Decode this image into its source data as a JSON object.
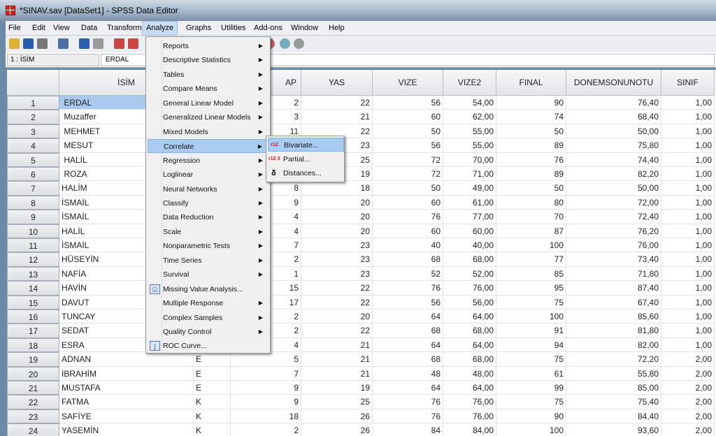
{
  "window": {
    "title": "*SINAV.sav [DataSet1] - SPSS Data Editor"
  },
  "menubar": [
    {
      "label": "File"
    },
    {
      "label": "Edit"
    },
    {
      "label": "View"
    },
    {
      "label": "Data"
    },
    {
      "label": "Transform"
    },
    {
      "label": "Analyze",
      "active": true
    },
    {
      "label": "Graphs"
    },
    {
      "label": "Utilities"
    },
    {
      "label": "Add-ons"
    },
    {
      "label": "Window"
    },
    {
      "label": "Help"
    }
  ],
  "toolbar": {
    "icons": [
      "open-folder-icon",
      "save-icon",
      "print-icon",
      "dialog-recall-icon",
      "undo-icon",
      "redo-icon",
      "goto-case-icon",
      "goto-variable-icon",
      "value-labels-icon",
      "use-sets-icon",
      "show-all-variables-icon"
    ]
  },
  "cellbar": {
    "ref": "1 : İSİM",
    "value": "ERDAL"
  },
  "columns": [
    "İSİM",
    "",
    "AP",
    "YAS",
    "VIZE",
    "VIZE2",
    "FINAL",
    "DONEMSONUNOTU",
    "SINIF"
  ],
  "rows": [
    [
      "1",
      " ERDAL",
      "",
      "2",
      "22",
      "56",
      "54,00",
      "90",
      "76,40",
      "1,00"
    ],
    [
      "2",
      " Muzaffer",
      "",
      "3",
      "21",
      "60",
      "62,00",
      "74",
      "68,40",
      "1,00"
    ],
    [
      "3",
      " MEHMET",
      "",
      "11",
      "22",
      "50",
      "55,00",
      "50",
      "50,00",
      "1,00"
    ],
    [
      "4",
      " MESUT",
      "",
      "",
      "23",
      "56",
      "55,00",
      "89",
      "75,80",
      "1,00"
    ],
    [
      "5",
      " HALİL",
      "",
      "",
      "25",
      "72",
      "70,00",
      "76",
      "74,40",
      "1,00"
    ],
    [
      "6",
      " ROZA",
      "",
      "",
      "19",
      "72",
      "71,00",
      "89",
      "82,20",
      "1,00"
    ],
    [
      "7",
      "HALİM",
      "",
      "8",
      "18",
      "50",
      "49,00",
      "50",
      "50,00",
      "1,00"
    ],
    [
      "8",
      "İSMAİL",
      "",
      "9",
      "20",
      "60",
      "61,00",
      "80",
      "72,00",
      "1,00"
    ],
    [
      "9",
      "İSMAİL",
      "",
      "4",
      "20",
      "76",
      "77,00",
      "70",
      "72,40",
      "1,00"
    ],
    [
      "10",
      "HALİL",
      "",
      "4",
      "20",
      "60",
      "60,00",
      "87",
      "76,20",
      "1,00"
    ],
    [
      "11",
      "İSMAİL",
      "",
      "7",
      "23",
      "40",
      "40,00",
      "100",
      "76,00",
      "1,00"
    ],
    [
      "12",
      "HÜSEYİN",
      "",
      "2",
      "23",
      "68",
      "68,00",
      "77",
      "73,40",
      "1,00"
    ],
    [
      "13",
      "NAFİA",
      "",
      "1",
      "23",
      "52",
      "52,00",
      "85",
      "71,80",
      "1,00"
    ],
    [
      "14",
      "HAVİN",
      "",
      "15",
      "22",
      "76",
      "76,00",
      "95",
      "87,40",
      "1,00"
    ],
    [
      "15",
      "DAVUT",
      "",
      "17",
      "22",
      "56",
      "56,00",
      "75",
      "67,40",
      "1,00"
    ],
    [
      "16",
      "TUNCAY",
      "",
      "2",
      "20",
      "64",
      "64,00",
      "100",
      "85,60",
      "1,00"
    ],
    [
      "17",
      "SEDAT",
      "",
      "2",
      "22",
      "68",
      "68,00",
      "91",
      "81,80",
      "1,00"
    ],
    [
      "18",
      "ESRA",
      "",
      "4",
      "21",
      "64",
      "64,00",
      "94",
      "82,00",
      "1,00"
    ],
    [
      "19",
      "ADNAN",
      "E",
      "5",
      "21",
      "68",
      "68,00",
      "75",
      "72,20",
      "2,00"
    ],
    [
      "20",
      "İBRAHİM",
      "E",
      "7",
      "21",
      "48",
      "48,00",
      "61",
      "55,80",
      "2,00"
    ],
    [
      "21",
      "MUSTAFA",
      "E",
      "9",
      "19",
      "64",
      "64,00",
      "99",
      "85,00",
      "2,00"
    ],
    [
      "22",
      "FATMA",
      "K",
      "9",
      "25",
      "76",
      "76,00",
      "75",
      "75,40",
      "2,00"
    ],
    [
      "23",
      "SAFİYE",
      "K",
      "18",
      "26",
      "76",
      "76,00",
      "90",
      "84,40",
      "2,00"
    ],
    [
      "24",
      "YASEMİN",
      "K",
      "2",
      "26",
      "84",
      "84,00",
      "100",
      "93,60",
      "2,00"
    ]
  ],
  "analyze_menu": [
    {
      "label": "Reports",
      "sub": true
    },
    {
      "label": "Descriptive Statistics",
      "sub": true
    },
    {
      "label": "Tables",
      "sub": true
    },
    {
      "label": "Compare Means",
      "sub": true
    },
    {
      "label": "General Linear Model",
      "sub": true
    },
    {
      "label": "Generalized Linear Models",
      "sub": true
    },
    {
      "label": "Mixed Models",
      "sub": true
    },
    {
      "label": "Correlate",
      "sub": true,
      "highlighted": true
    },
    {
      "label": "Regression",
      "sub": true
    },
    {
      "label": "Loglinear",
      "sub": true
    },
    {
      "label": "Neural Networks",
      "sub": true
    },
    {
      "label": "Classify",
      "sub": true
    },
    {
      "label": "Data Reduction",
      "sub": true
    },
    {
      "label": "Scale",
      "sub": true
    },
    {
      "label": "Nonparametric Tests",
      "sub": true
    },
    {
      "label": "Time Series",
      "sub": true
    },
    {
      "label": "Survival",
      "sub": true
    },
    {
      "label": "Missing Value Analysis...",
      "icon": "missing-value-icon"
    },
    {
      "label": "Multiple Response",
      "sub": true
    },
    {
      "label": "Complex Samples",
      "sub": true
    },
    {
      "label": "Quality Control",
      "sub": true
    },
    {
      "label": "ROC Curve...",
      "icon": "roc-curve-icon"
    }
  ],
  "correlate_submenu": [
    {
      "label": "Bivariate...",
      "icon": "r12",
      "highlighted": true
    },
    {
      "label": "Partial...",
      "icon": "r12·3"
    },
    {
      "label": "Distances...",
      "icon": "δ"
    }
  ],
  "colors": {
    "selection": "#a9c9ef",
    "menu_highlight": "#a9cdf2",
    "accent": "#cc2222"
  }
}
